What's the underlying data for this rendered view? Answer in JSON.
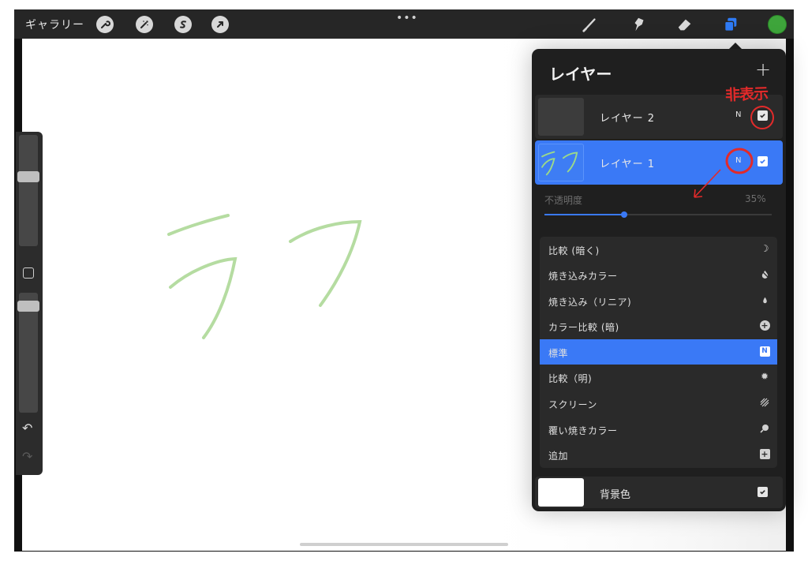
{
  "topbar": {
    "gallery_label": "ギャラリー",
    "left_tools": [
      "wrench-icon",
      "magic-wand-icon",
      "selection-icon",
      "transform-arrow-icon"
    ],
    "more_dots": "•••",
    "right_tools": [
      "brush-icon",
      "smudge-icon",
      "eraser-icon",
      "layers-icon"
    ],
    "color_swatch": "#3ea53b"
  },
  "sidebar": {
    "undo_label": "↶",
    "redo_label": "↷"
  },
  "layers_panel": {
    "title": "レイヤー",
    "add_label": "+",
    "layers": [
      {
        "name": "レイヤー 2",
        "blend": "N",
        "visible": true,
        "selected": false
      },
      {
        "name": "レイヤー 1",
        "blend": "N",
        "visible": true,
        "selected": true
      }
    ],
    "opacity_label": "不透明度",
    "opacity_value": "35%",
    "opacity_fraction": 0.35,
    "blend_modes": [
      {
        "label": "比較 (暗く)",
        "icon": "moon-icon",
        "active": false
      },
      {
        "label": "焼き込みカラー",
        "icon": "burn-icon",
        "active": false
      },
      {
        "label": "焼き込み（リニア)",
        "icon": "flame-icon",
        "active": false
      },
      {
        "label": "カラー比較 (暗)",
        "icon": "plus-circle-icon",
        "active": false
      },
      {
        "label": "標準",
        "icon": "n-badge-icon",
        "active": true
      },
      {
        "label": "比較（明)",
        "icon": "sun-icon",
        "active": false
      },
      {
        "label": "スクリーン",
        "icon": "stripes-icon",
        "active": false
      },
      {
        "label": "覆い焼きカラー",
        "icon": "brush-dab-icon",
        "active": false
      },
      {
        "label": "追加",
        "icon": "plus-box-icon",
        "active": false
      }
    ],
    "background_layer": {
      "name": "背景色",
      "visible": true
    }
  },
  "annotation": {
    "hidden_label": "非表示",
    "color": "#e22a2a"
  },
  "canvas_sketch_color": "#b5dca1"
}
